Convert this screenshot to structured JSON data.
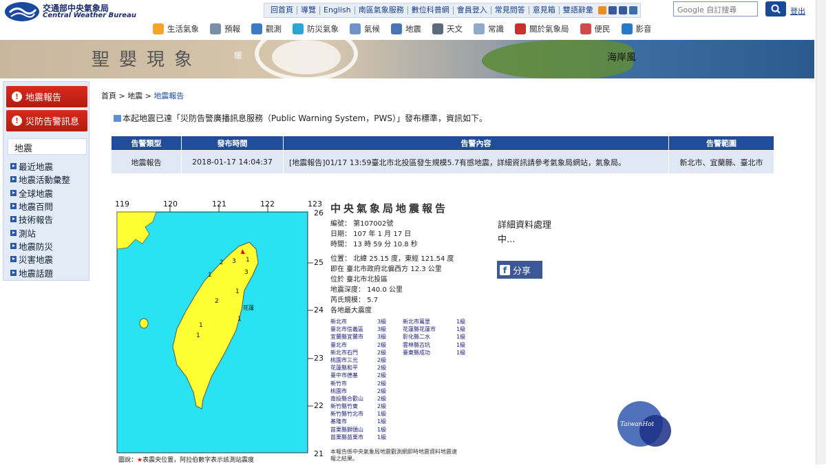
{
  "header": {
    "logo_zh": "交通部中央氣象局",
    "logo_en": "Central Weather Bureau",
    "top_links": [
      "回首頁",
      "導覽",
      "English",
      "南區氣象服務",
      "數位科普網",
      "會員登入",
      "常見問答",
      "意見箱",
      "雙語辭彙"
    ],
    "search_placeholder": "Google 自訂搜尋",
    "login_label": "登出",
    "nav": [
      {
        "label": "生活氣象",
        "color": "#f2a52b"
      },
      {
        "label": "預報",
        "color": "#7a8ea8"
      },
      {
        "label": "觀測",
        "color": "#3c79c7"
      },
      {
        "label": "防災氣象",
        "color": "#2aa6d6"
      },
      {
        "label": "氣候",
        "color": "#6f93c8"
      },
      {
        "label": "地震",
        "color": "#4c74b5"
      },
      {
        "label": "天文",
        "color": "#5d6a7c"
      },
      {
        "label": "常識",
        "color": "#8fa9c8"
      },
      {
        "label": "關於氣象局",
        "color": "#c9302c"
      },
      {
        "label": "便民",
        "color": "#d24a4a"
      },
      {
        "label": "影音",
        "color": "#2779c9"
      }
    ]
  },
  "banner": {
    "title": "聖嬰現象",
    "word1": "暖",
    "word2": "海岸風"
  },
  "sidebar": {
    "buttons": [
      "地震報告",
      "災防告警訊息"
    ],
    "section": "地震",
    "items": [
      "最近地震",
      "地震活動彙整",
      "全球地震",
      "地震百問",
      "技術報告",
      "測站",
      "地震防災",
      "災害地震",
      "地震話題"
    ]
  },
  "breadcrumb": {
    "home": "首頁",
    "sep": ">",
    "level1": "地震",
    "current": "地震報告"
  },
  "notice": "本起地震已達「災防告警廣播訊息服務（Public Warning System，PWS）」發布標準，資訊如下。",
  "pws_table": {
    "headers": [
      "告警類型",
      "發布時間",
      "告警內容",
      "告警範圍"
    ],
    "row": [
      "地震報告",
      "2018-01-17 14:04:37",
      "[地震報告]01/17 13:59臺北市北投區發生規模5.7有感地震，詳細資訊請參考氣象局網站，氣象局。",
      "新北市、宜蘭縣、臺北市"
    ]
  },
  "map": {
    "lon_ticks": [
      "119",
      "120",
      "121",
      "122",
      "123"
    ],
    "lat_ticks": [
      "26",
      "25",
      "24",
      "23",
      "22",
      "21"
    ],
    "labels": {
      "hualien": "花蓮"
    },
    "legend_prefix": "圖說：",
    "legend_star": "★",
    "legend_text": "表震央位置，阿拉伯數字表示該測站震度"
  },
  "report": {
    "title": "中央氣象局地震報告",
    "no": "編號： 第107002號",
    "date": "日期： 107 年 1 月 17 日",
    "time": "時間： 13 時 59 分 10.8 秒",
    "loc1": "位置： 北緯 25.15 度，東經 121.54 度",
    "loc2": "即在 臺北市政府北偏西方 12.3 公里",
    "loc3": "位於 臺北市北投區",
    "depth": "地震深度： 140.0 公里",
    "mag": "芮氏規模： 5.7",
    "max_head": "各地最大震度",
    "intensity_left": [
      {
        "name": "新北市",
        "lv": "3級"
      },
      {
        "name": "臺北市信義區",
        "lv": "3級"
      },
      {
        "name": "宜蘭縣宜蘭市",
        "lv": "3級"
      },
      {
        "name": "臺北市",
        "lv": "2級"
      },
      {
        "name": "新北市石門",
        "lv": "2級"
      },
      {
        "name": "桃園市三光",
        "lv": "2級"
      },
      {
        "name": "花蓮縣和平",
        "lv": "2級"
      },
      {
        "name": "臺中市德基",
        "lv": "2級"
      },
      {
        "name": "新竹市",
        "lv": "2級"
      },
      {
        "name": "桃園市",
        "lv": "2級"
      },
      {
        "name": "南投縣合歡山",
        "lv": "2級"
      },
      {
        "name": "新竹縣竹東",
        "lv": "2級"
      },
      {
        "name": "新竹縣竹北市",
        "lv": "1級"
      },
      {
        "name": "基隆市",
        "lv": "1級"
      },
      {
        "name": "苗栗縣獅頭山",
        "lv": "1級"
      },
      {
        "name": "苗栗縣苗栗市",
        "lv": "1級"
      }
    ],
    "intensity_right": [
      {
        "name": "新北市萬里",
        "lv": "1級"
      },
      {
        "name": "花蓮縣花蓮市",
        "lv": "1級"
      },
      {
        "name": "彰化縣二水",
        "lv": "1級"
      },
      {
        "name": "雲林縣古坑",
        "lv": "1級"
      },
      {
        "name": "臺東縣成功",
        "lv": "1級"
      }
    ],
    "footnote": "本報告係中央氣象局地震觀測網即時地震資料地震速報之結果。"
  },
  "detail": {
    "line1": "詳細資料處理",
    "line2": "中..."
  },
  "share_label": "分享",
  "watermark": "TaiwanHot"
}
